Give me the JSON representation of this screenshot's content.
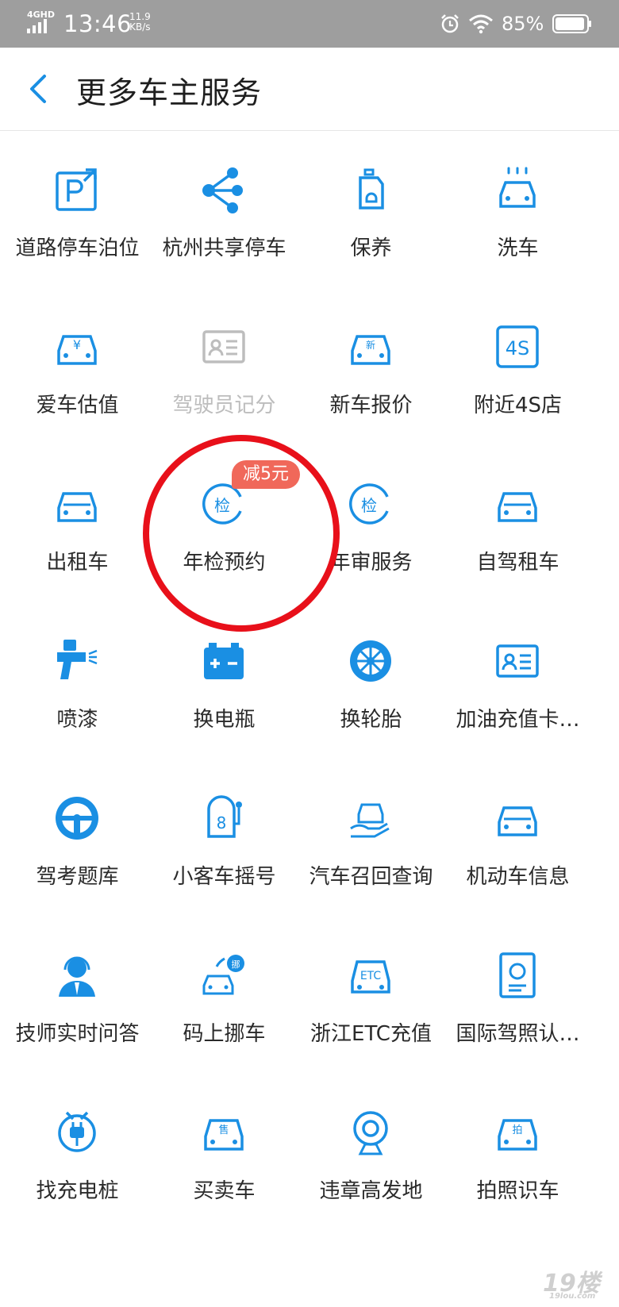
{
  "status_bar": {
    "network": "4GHD",
    "time": "13:46",
    "speed_value": "11.9",
    "speed_unit": "KB/s",
    "battery": "85%"
  },
  "header": {
    "back_icon": "chevron-left-icon",
    "title": "更多车主服务"
  },
  "colors": {
    "accent": "#1a8fe3",
    "text": "#2a2a2a",
    "disabled": "#bdbdbd",
    "badge": "#f0685a",
    "highlight_circle": "#e8101a",
    "statusbar": "#9e9e9e"
  },
  "services": [
    {
      "label": "道路停车泊位",
      "icon": "parking-icon"
    },
    {
      "label": "杭州共享停车",
      "icon": "share-icon"
    },
    {
      "label": "保养",
      "icon": "oil-bottle-icon"
    },
    {
      "label": "洗车",
      "icon": "car-wash-icon"
    },
    {
      "label": "爱车估值",
      "icon": "car-valuation-icon"
    },
    {
      "label": "驾驶员记分",
      "icon": "driver-card-icon",
      "disabled": true
    },
    {
      "label": "新车报价",
      "icon": "new-car-icon"
    },
    {
      "label": "附近4S店",
      "icon": "4s-store-icon"
    },
    {
      "label": "出租车",
      "icon": "taxi-icon"
    },
    {
      "label": "年检预约",
      "icon": "inspection-icon",
      "badge": "减5元"
    },
    {
      "label": "年审服务",
      "icon": "inspection-icon"
    },
    {
      "label": "自驾租车",
      "icon": "car-rental-icon"
    },
    {
      "label": "喷漆",
      "icon": "spray-gun-icon"
    },
    {
      "label": "换电瓶",
      "icon": "battery-icon"
    },
    {
      "label": "换轮胎",
      "icon": "tire-icon"
    },
    {
      "label": "加油充值卡…",
      "icon": "fuel-card-icon"
    },
    {
      "label": "驾考题库",
      "icon": "steering-wheel-icon"
    },
    {
      "label": "小客车摇号",
      "icon": "lottery-icon"
    },
    {
      "label": "汽车召回查询",
      "icon": "recall-icon"
    },
    {
      "label": "机动车信息",
      "icon": "vehicle-info-icon"
    },
    {
      "label": "技师实时问答",
      "icon": "technician-icon"
    },
    {
      "label": "码上挪车",
      "icon": "move-car-icon"
    },
    {
      "label": "浙江ETC充值",
      "icon": "etc-icon"
    },
    {
      "label": "国际驾照认…",
      "icon": "intl-license-icon"
    },
    {
      "label": "找充电桩",
      "icon": "charging-plug-icon"
    },
    {
      "label": "买卖车",
      "icon": "car-sale-icon"
    },
    {
      "label": "违章高发地",
      "icon": "camera-icon"
    },
    {
      "label": "拍照识车",
      "icon": "photo-car-icon"
    }
  ],
  "watermark": {
    "big": "19楼",
    "small": "19lou.com"
  }
}
